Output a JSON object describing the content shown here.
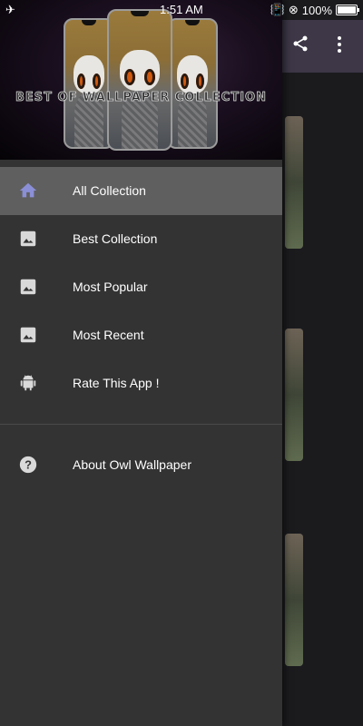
{
  "status_bar": {
    "time": "1:51 AM",
    "battery": "100%"
  },
  "header": {
    "banner_text": "BEST OF WALLPAPER COLLECTION"
  },
  "menu": {
    "items": [
      {
        "label": "All Collection",
        "icon": "home-icon",
        "active": true
      },
      {
        "label": "Best Collection",
        "icon": "image-icon"
      },
      {
        "label": "Most Popular",
        "icon": "image-icon"
      },
      {
        "label": "Most Recent",
        "icon": "image-icon"
      },
      {
        "label": "Rate This App !",
        "icon": "android-icon"
      }
    ],
    "secondary": [
      {
        "label": "About Owl Wallpaper",
        "icon": "help-icon"
      }
    ]
  },
  "colors": {
    "drawer_bg": "#333333",
    "active_item_bg": "#5f5f5f",
    "home_icon": "#8b8fd6",
    "toolbar_bg": "#3d3747"
  }
}
